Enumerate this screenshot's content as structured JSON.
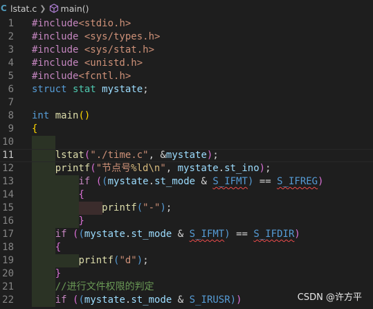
{
  "breadcrumb": {
    "file_icon": "C",
    "file": "lstat.c",
    "symbol": "main()"
  },
  "lines": [
    {
      "n": "1",
      "t": [
        [
          "#include",
          "pp"
        ],
        [
          "<stdio.h>",
          "str"
        ]
      ]
    },
    {
      "n": "2",
      "t": [
        [
          "#include ",
          "pp"
        ],
        [
          "<sys/types.h>",
          "str"
        ]
      ]
    },
    {
      "n": "3",
      "t": [
        [
          "#include ",
          "pp"
        ],
        [
          "<sys/stat.h>",
          "str"
        ]
      ]
    },
    {
      "n": "4",
      "t": [
        [
          "#include ",
          "pp"
        ],
        [
          "<unistd.h>",
          "str"
        ]
      ]
    },
    {
      "n": "5",
      "t": [
        [
          "#include",
          "pp"
        ],
        [
          "<fcntl.h>",
          "str"
        ]
      ]
    },
    {
      "n": "6",
      "t": [
        [
          "struct ",
          "kw"
        ],
        [
          "stat ",
          "type"
        ],
        [
          "mystate",
          "var"
        ],
        [
          ";",
          "plain"
        ]
      ]
    },
    {
      "n": "7",
      "t": []
    },
    {
      "n": "8",
      "t": [
        [
          "int ",
          "kw"
        ],
        [
          "main",
          "fn"
        ],
        [
          "()",
          "brace"
        ]
      ]
    },
    {
      "n": "9",
      "t": [
        [
          "{",
          "brace"
        ]
      ]
    },
    {
      "n": "10",
      "t": []
    },
    {
      "n": "11",
      "t": [
        [
          "    ",
          "plain"
        ],
        [
          "lstat",
          "fn"
        ],
        [
          "(",
          "paren2"
        ],
        [
          "\"./time.c\"",
          "str"
        ],
        [
          ", &",
          "plain"
        ],
        [
          "mystate",
          "var"
        ],
        [
          ")",
          "paren2"
        ],
        [
          ";",
          "plain"
        ]
      ]
    },
    {
      "n": "12",
      "t": [
        [
          "    ",
          "plain"
        ],
        [
          "printf",
          "fn"
        ],
        [
          "(",
          "paren2"
        ],
        [
          "\"节点号",
          "str"
        ],
        [
          "%ld\\n",
          "esc"
        ],
        [
          "\"",
          "str"
        ],
        [
          ", ",
          "plain"
        ],
        [
          "mystate",
          "var"
        ],
        [
          ".",
          "plain"
        ],
        [
          "st_ino",
          "var"
        ],
        [
          ")",
          "paren2"
        ],
        [
          ";",
          "plain"
        ]
      ]
    },
    {
      "n": "13",
      "t": [
        [
          "        ",
          "plain"
        ],
        [
          "if ",
          "pp"
        ],
        [
          "(",
          "paren2"
        ],
        [
          "(",
          "kw"
        ],
        [
          "mystate",
          "var"
        ],
        [
          ".",
          "plain"
        ],
        [
          "st_mode",
          "var"
        ],
        [
          " & ",
          "plain"
        ],
        [
          "S_IFMT",
          "sq"
        ],
        [
          ")",
          "kw"
        ],
        [
          " == ",
          "plain"
        ],
        [
          "S_IFREG",
          "sq"
        ],
        [
          ")",
          "paren2"
        ]
      ]
    },
    {
      "n": "14",
      "t": [
        [
          "        ",
          "plain"
        ],
        [
          "{",
          "paren2"
        ]
      ]
    },
    {
      "n": "15",
      "t": [
        [
          "            ",
          "plain"
        ],
        [
          "printf",
          "fn"
        ],
        [
          "(",
          "kw"
        ],
        [
          "\"-\"",
          "str"
        ],
        [
          ")",
          "kw"
        ],
        [
          ";",
          "plain"
        ]
      ]
    },
    {
      "n": "16",
      "t": [
        [
          "        ",
          "plain"
        ],
        [
          "}",
          "paren2"
        ]
      ]
    },
    {
      "n": "17",
      "t": [
        [
          "    ",
          "plain"
        ],
        [
          "if ",
          "pp"
        ],
        [
          "(",
          "paren2"
        ],
        [
          "(",
          "kw"
        ],
        [
          "mystate",
          "var"
        ],
        [
          ".",
          "plain"
        ],
        [
          "st_mode",
          "var"
        ],
        [
          " & ",
          "plain"
        ],
        [
          "S_IFMT",
          "sq"
        ],
        [
          ")",
          "kw"
        ],
        [
          " == ",
          "plain"
        ],
        [
          "S_IFDIR",
          "sq"
        ],
        [
          ")",
          "paren2"
        ]
      ]
    },
    {
      "n": "18",
      "t": [
        [
          "    ",
          "plain"
        ],
        [
          "{",
          "paren2"
        ]
      ]
    },
    {
      "n": "19",
      "t": [
        [
          "        ",
          "plain"
        ],
        [
          "printf",
          "fn"
        ],
        [
          "(",
          "kw"
        ],
        [
          "\"d\"",
          "str"
        ],
        [
          ")",
          "kw"
        ],
        [
          ";",
          "plain"
        ]
      ]
    },
    {
      "n": "20",
      "t": [
        [
          "    ",
          "plain"
        ],
        [
          "}",
          "paren2"
        ]
      ]
    },
    {
      "n": "21",
      "t": [
        [
          "    ",
          "plain"
        ],
        [
          "//进行文件权限的判定",
          "cm"
        ]
      ]
    },
    {
      "n": "22",
      "t": [
        [
          "    ",
          "plain"
        ],
        [
          "if ",
          "pp"
        ],
        [
          "(",
          "paren2"
        ],
        [
          "(",
          "kw"
        ],
        [
          "mystate",
          "var"
        ],
        [
          ".",
          "plain"
        ],
        [
          "st_mode",
          "var"
        ],
        [
          " & ",
          "plain"
        ],
        [
          "S_IRUSR",
          "mac"
        ],
        [
          ")",
          "kw"
        ],
        [
          ")",
          "paren2"
        ]
      ]
    }
  ],
  "active_line": "11",
  "watermark": "CSDN @许方平",
  "colors": {
    "background": "#1e1e1e",
    "preprocessor": "#c586c0",
    "string": "#ce9178",
    "keyword": "#569cd6",
    "type": "#4ec9b0",
    "variable": "#9cdcfe",
    "function": "#dcdcaa",
    "comment": "#6a9955",
    "squiggle": "#f14c4c"
  }
}
